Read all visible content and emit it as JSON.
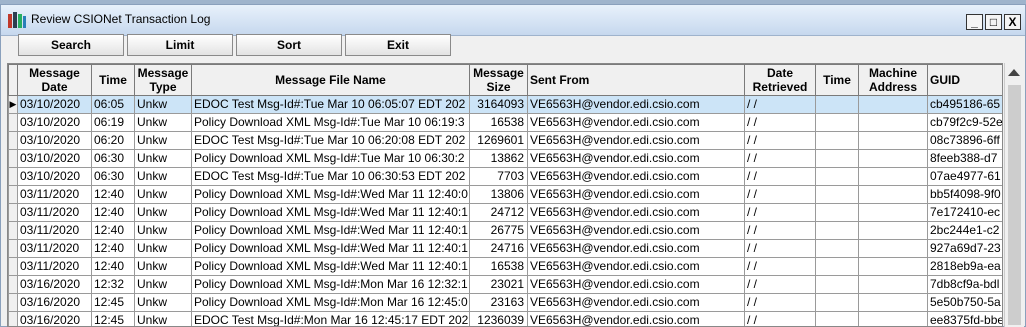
{
  "window": {
    "title": "Review CSIONet Transaction Log"
  },
  "window_controls": {
    "minimize": "_",
    "maximize": "□",
    "close": "X"
  },
  "toolbar": {
    "search": "Search",
    "limit": "Limit",
    "sort": "Sort",
    "exit": "Exit"
  },
  "table": {
    "headers": {
      "date": "Message Date",
      "time": "Time",
      "type": "Message Type",
      "file": "Message File Name",
      "size": "Message Size",
      "sent": "Sent From",
      "retrieved": "Date Retrieved",
      "time2": "Time",
      "machine": "Machine Address",
      "guid": "GUID"
    },
    "selected_indicator": "▶",
    "rows": [
      {
        "date": "03/10/2020",
        "time": "06:05",
        "type": "Unkw",
        "file": "EDOC Test Msg-Id#:Tue Mar 10 06:05:07 EDT 202",
        "size": "3164093",
        "sent": "VE6563H@vendor.edi.csio.com",
        "retrieved": "/ /",
        "time2": "",
        "machine": "",
        "guid": "cb495186-65"
      },
      {
        "date": "03/10/2020",
        "time": "06:19",
        "type": "Unkw",
        "file": "Policy Download XML Msg-Id#:Tue Mar 10 06:19:3",
        "size": "16538",
        "sent": "VE6563H@vendor.edi.csio.com",
        "retrieved": "/ /",
        "time2": "",
        "machine": "",
        "guid": "cb79f2c9-52e"
      },
      {
        "date": "03/10/2020",
        "time": "06:20",
        "type": "Unkw",
        "file": "EDOC Test Msg-Id#:Tue Mar 10 06:20:08 EDT 202",
        "size": "1269601",
        "sent": "VE6563H@vendor.edi.csio.com",
        "retrieved": "/ /",
        "time2": "",
        "machine": "",
        "guid": "08c73896-6ff"
      },
      {
        "date": "03/10/2020",
        "time": "06:30",
        "type": "Unkw",
        "file": "Policy Download XML Msg-Id#:Tue Mar 10 06:30:2",
        "size": "13862",
        "sent": "VE6563H@vendor.edi.csio.com",
        "retrieved": "/ /",
        "time2": "",
        "machine": "",
        "guid": "8feeb388-d7"
      },
      {
        "date": "03/10/2020",
        "time": "06:30",
        "type": "Unkw",
        "file": "EDOC Test Msg-Id#:Tue Mar 10 06:30:53 EDT 202",
        "size": "7703",
        "sent": "VE6563H@vendor.edi.csio.com",
        "retrieved": "/ /",
        "time2": "",
        "machine": "",
        "guid": "07ae4977-61"
      },
      {
        "date": "03/11/2020",
        "time": "12:40",
        "type": "Unkw",
        "file": "Policy Download XML Msg-Id#:Wed Mar 11 12:40:0",
        "size": "13806",
        "sent": "VE6563H@vendor.edi.csio.com",
        "retrieved": "/ /",
        "time2": "",
        "machine": "",
        "guid": "bb5f4098-9f0"
      },
      {
        "date": "03/11/2020",
        "time": "12:40",
        "type": "Unkw",
        "file": "Policy Download XML Msg-Id#:Wed Mar 11 12:40:1",
        "size": "24712",
        "sent": "VE6563H@vendor.edi.csio.com",
        "retrieved": "/ /",
        "time2": "",
        "machine": "",
        "guid": "7e172410-ec"
      },
      {
        "date": "03/11/2020",
        "time": "12:40",
        "type": "Unkw",
        "file": "Policy Download XML Msg-Id#:Wed Mar 11 12:40:1",
        "size": "26775",
        "sent": "VE6563H@vendor.edi.csio.com",
        "retrieved": "/ /",
        "time2": "",
        "machine": "",
        "guid": "2bc244e1-c2"
      },
      {
        "date": "03/11/2020",
        "time": "12:40",
        "type": "Unkw",
        "file": "Policy Download XML Msg-Id#:Wed Mar 11 12:40:1",
        "size": "24716",
        "sent": "VE6563H@vendor.edi.csio.com",
        "retrieved": "/ /",
        "time2": "",
        "machine": "",
        "guid": "927a69d7-23"
      },
      {
        "date": "03/11/2020",
        "time": "12:40",
        "type": "Unkw",
        "file": "Policy Download XML Msg-Id#:Wed Mar 11 12:40:1",
        "size": "16538",
        "sent": "VE6563H@vendor.edi.csio.com",
        "retrieved": "/ /",
        "time2": "",
        "machine": "",
        "guid": "2818eb9a-ea"
      },
      {
        "date": "03/16/2020",
        "time": "12:32",
        "type": "Unkw",
        "file": "Policy Download XML Msg-Id#:Mon Mar 16 12:32:1",
        "size": "23021",
        "sent": "VE6563H@vendor.edi.csio.com",
        "retrieved": "/ /",
        "time2": "",
        "machine": "",
        "guid": "7db8cf9a-bdl"
      },
      {
        "date": "03/16/2020",
        "time": "12:45",
        "type": "Unkw",
        "file": "Policy Download XML Msg-Id#:Mon Mar 16 12:45:0",
        "size": "23163",
        "sent": "VE6563H@vendor.edi.csio.com",
        "retrieved": "/ /",
        "time2": "",
        "machine": "",
        "guid": "5e50b750-5a"
      },
      {
        "date": "03/16/2020",
        "time": "12:45",
        "type": "Unkw",
        "file": "EDOC Test Msg-Id#:Mon Mar 16 12:45:17 EDT 202",
        "size": "1236039",
        "sent": "VE6563H@vendor.edi.csio.com",
        "retrieved": "/ /",
        "time2": "",
        "machine": "",
        "guid": "ee8375fd-bbe"
      }
    ]
  }
}
